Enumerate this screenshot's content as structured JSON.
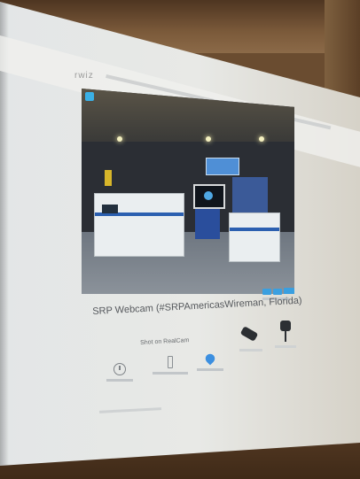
{
  "page": {
    "brand": "rwiz",
    "stream_title": "SRP Webcam (#SRPAmericasWireman, Florida)",
    "shot_heading": "Shot on RealCam",
    "feature_items": [
      {
        "icon": "clock-icon"
      },
      {
        "icon": "timer-icon"
      },
      {
        "icon": "location-pin-icon"
      }
    ],
    "product_items": [
      {
        "icon": "camera-icon"
      },
      {
        "icon": "webcam-icon"
      }
    ],
    "video_buttons": [
      {
        "icon": "share-button"
      },
      {
        "icon": "embed-button"
      },
      {
        "icon": "fullscreen-button"
      }
    ]
  },
  "colors": {
    "accent_blue": "#3a9fe0",
    "screen_bg": "#e6e8e7",
    "title_text": "#55585c"
  }
}
